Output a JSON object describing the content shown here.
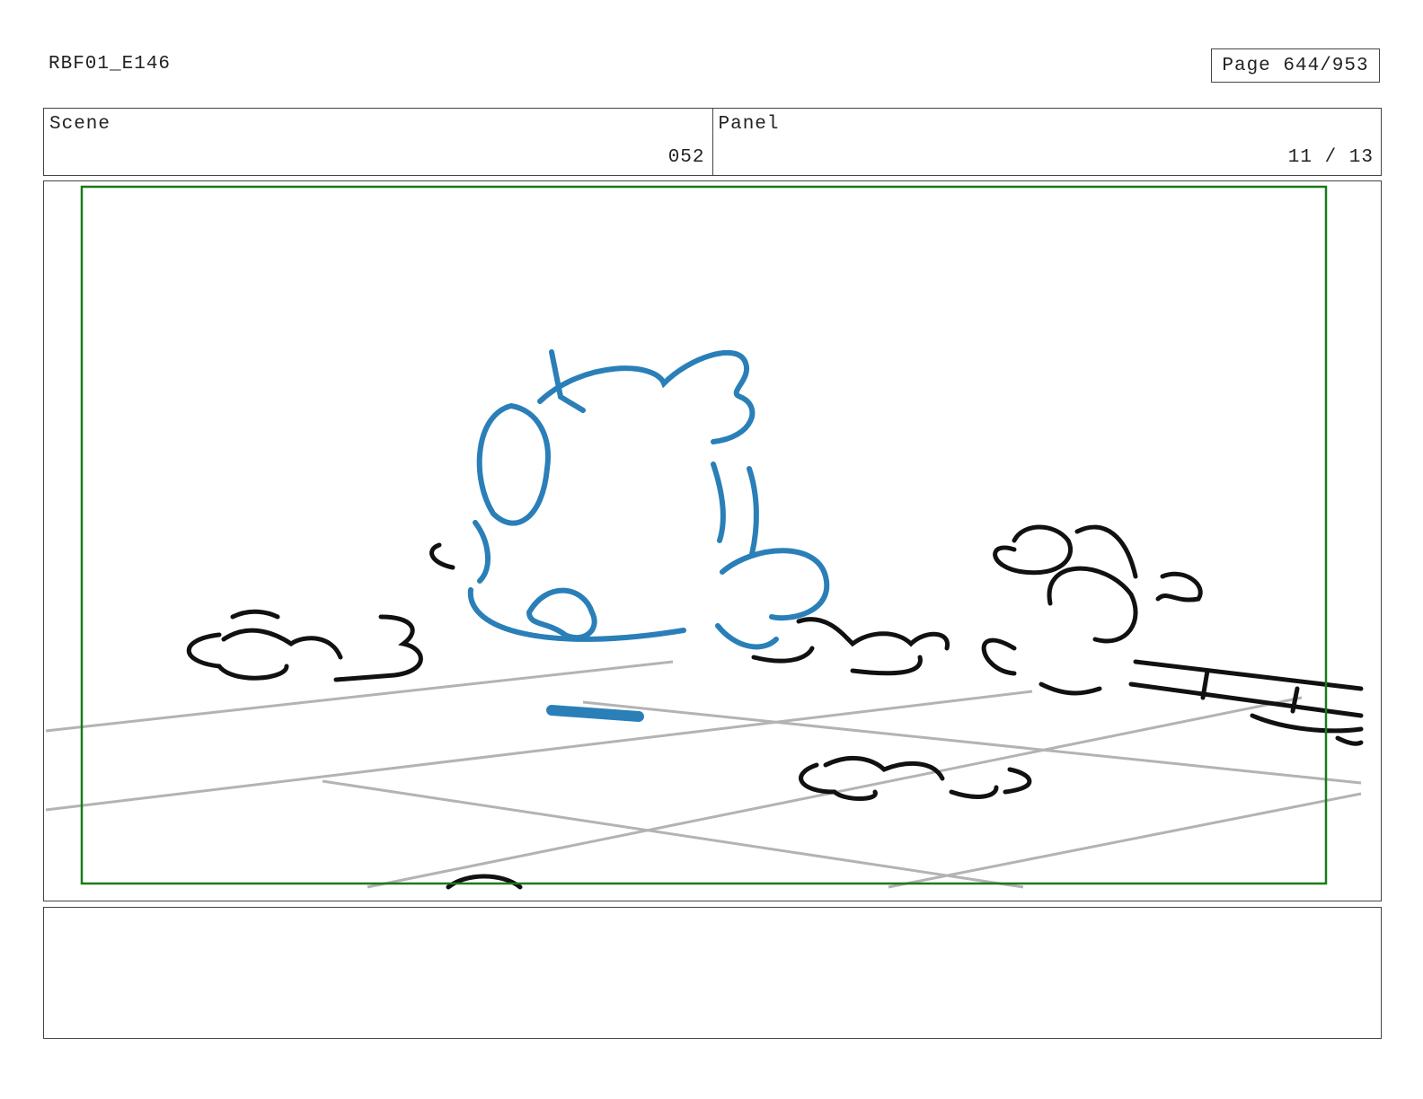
{
  "header": {
    "doc_id": "RBF01_E146",
    "page_label": "Page 644/953"
  },
  "info": {
    "scene_label": "Scene",
    "scene_value": "052",
    "panel_label": "Panel",
    "panel_value": "11 / 13"
  },
  "notes": {
    "text": ""
  },
  "colors": {
    "safe_frame": "#1a7a1a",
    "character_sketch": "#2a7fb8",
    "ink": "#111111",
    "floor_lines": "#b3b3b3"
  }
}
